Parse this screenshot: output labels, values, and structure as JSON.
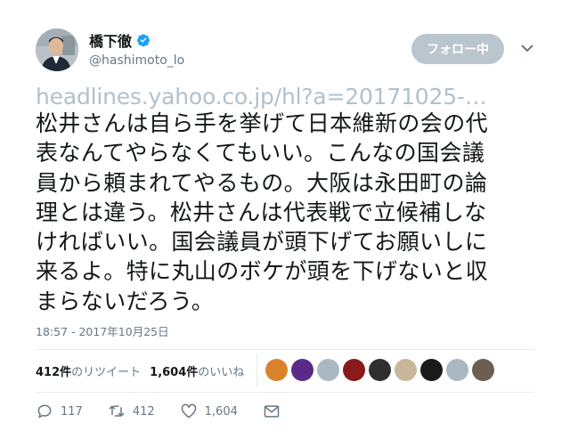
{
  "user": {
    "display_name": "橋下徹",
    "handle": "@hashimoto_lo"
  },
  "follow_button_label": "フォロー中",
  "tweet": {
    "link": "headlines.yahoo.co.jp/hl?a=20171025-…",
    "lines": [
      "松井さんは自ら手を挙げて日本維新の会の代",
      "表なんてやらなくてもいい。こんなの国会議",
      "員から頼まれてやるもの。大阪は永田町の論",
      "理とは違う。松井さんは代表戦で立候補しな",
      "ければいい。国会議員が頭下げてお願いしに",
      "来るよ。特に丸山のボケが頭を下げないと収",
      "まらないだろう。"
    ],
    "timestamp": "18:57 - 2017年10月25日"
  },
  "stats": {
    "retweets_count": "412件",
    "retweets_label": "のリツイート",
    "likes_count": "1,604件",
    "likes_label": "のいいね"
  },
  "likers": [
    {
      "icon": "liker-avatar-1",
      "color": "#d9822b"
    },
    {
      "icon": "liker-avatar-2",
      "color": "#5b2a86"
    },
    {
      "icon": "liker-avatar-3",
      "color": "#aab8c2"
    },
    {
      "icon": "liker-avatar-4",
      "color": "#8b1a1a"
    },
    {
      "icon": "liker-avatar-5",
      "color": "#2f2f2f"
    },
    {
      "icon": "liker-avatar-6",
      "color": "#c9b79c"
    },
    {
      "icon": "liker-avatar-7",
      "color": "#1a1a1a"
    },
    {
      "icon": "liker-avatar-8",
      "color": "#aab8c2"
    },
    {
      "icon": "liker-avatar-9",
      "color": "#6b5f52"
    }
  ],
  "actions": {
    "reply_count": "117",
    "retweet_count": "412",
    "like_count": "1,604"
  },
  "colors": {
    "verified": "#1da1f2",
    "follow_button_bg": "#b9c6ce",
    "link": "#b1c1cc",
    "secondary_text": "#657786"
  }
}
